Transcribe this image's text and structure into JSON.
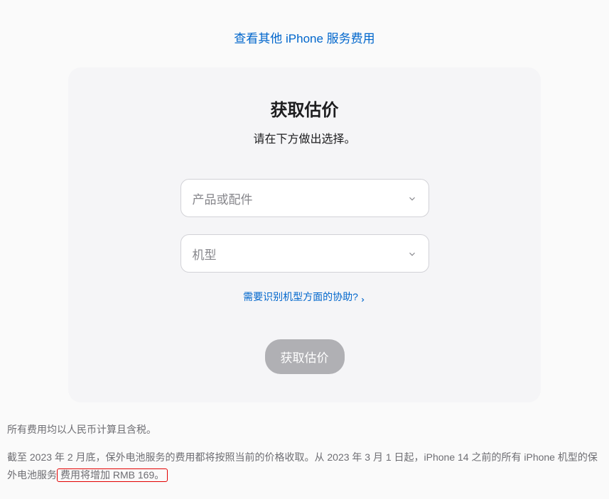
{
  "topLink": {
    "label": "查看其他 iPhone 服务费用"
  },
  "card": {
    "title": "获取估价",
    "subtitle": "请在下方做出选择。",
    "select1": {
      "placeholder": "产品或配件"
    },
    "select2": {
      "placeholder": "机型"
    },
    "helpLink": {
      "label": "需要识别机型方面的协助?"
    },
    "submitButton": {
      "label": "获取估价"
    }
  },
  "footer": {
    "line1": "所有费用均以人民币计算且含税。",
    "line2_part1": "截至 2023 年 2 月底，保外电池服务的费用都将按照当前的价格收取。从 2023 年 3 月 1 日起，iPhone 14 之前的所有 iPhone 机型的保外电池服务",
    "line2_highlight": "费用将增加 RMB 169。"
  }
}
